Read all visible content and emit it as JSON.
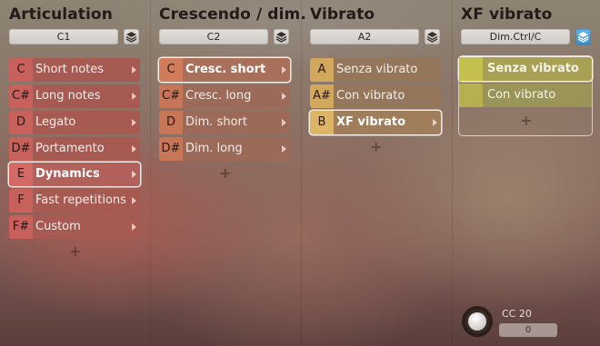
{
  "columns": [
    {
      "title": "Articulation",
      "selector": "C1",
      "items": [
        {
          "key": "C",
          "label": "Short notes"
        },
        {
          "key": "C#",
          "label": "Long notes"
        },
        {
          "key": "D",
          "label": "Legato"
        },
        {
          "key": "D#",
          "label": "Portamento"
        },
        {
          "key": "E",
          "label": "Dynamics",
          "selected": true
        },
        {
          "key": "F",
          "label": "Fast repetitions"
        },
        {
          "key": "F#",
          "label": "Custom"
        }
      ],
      "add_label": "+"
    },
    {
      "title": "Crescendo / dim.",
      "selector": "C2",
      "items": [
        {
          "key": "C",
          "label": "Cresc. short",
          "selected": true
        },
        {
          "key": "C#",
          "label": "Cresc. long"
        },
        {
          "key": "D",
          "label": "Dim. short"
        },
        {
          "key": "D#",
          "label": "Dim. long"
        }
      ],
      "add_label": "+"
    },
    {
      "title": "Vibrato",
      "selector": "A2",
      "items": [
        {
          "key": "A",
          "label": "Senza vibrato"
        },
        {
          "key": "A#",
          "label": "Con vibrato"
        },
        {
          "key": "B",
          "label": "XF vibrato",
          "selected": true
        }
      ],
      "add_label": "+"
    },
    {
      "title": "XF vibrato",
      "selector": "Dim.Ctrl/C",
      "items": [
        {
          "label": "Senza vibrato",
          "selected": true
        },
        {
          "label": "Con vibrato"
        }
      ],
      "add_label": "+",
      "controller": {
        "label": "CC 20",
        "value": "0"
      }
    }
  ],
  "colors": {
    "articulation_key": "#c8605c",
    "articulation_row": "#a65a52",
    "crescendo_key": "#c87658",
    "crescendo_row": "#9c6a58",
    "vibrato_key": "#d2a95c",
    "vibrato_row": "#94765a",
    "xf_key": "#c4c04e",
    "xf_row": "#a8a052",
    "layers_active": "#3a92cf"
  },
  "icons": {
    "layers": "layers-icon",
    "arrow": "chevron-right-icon",
    "knob": "knob-icon"
  }
}
